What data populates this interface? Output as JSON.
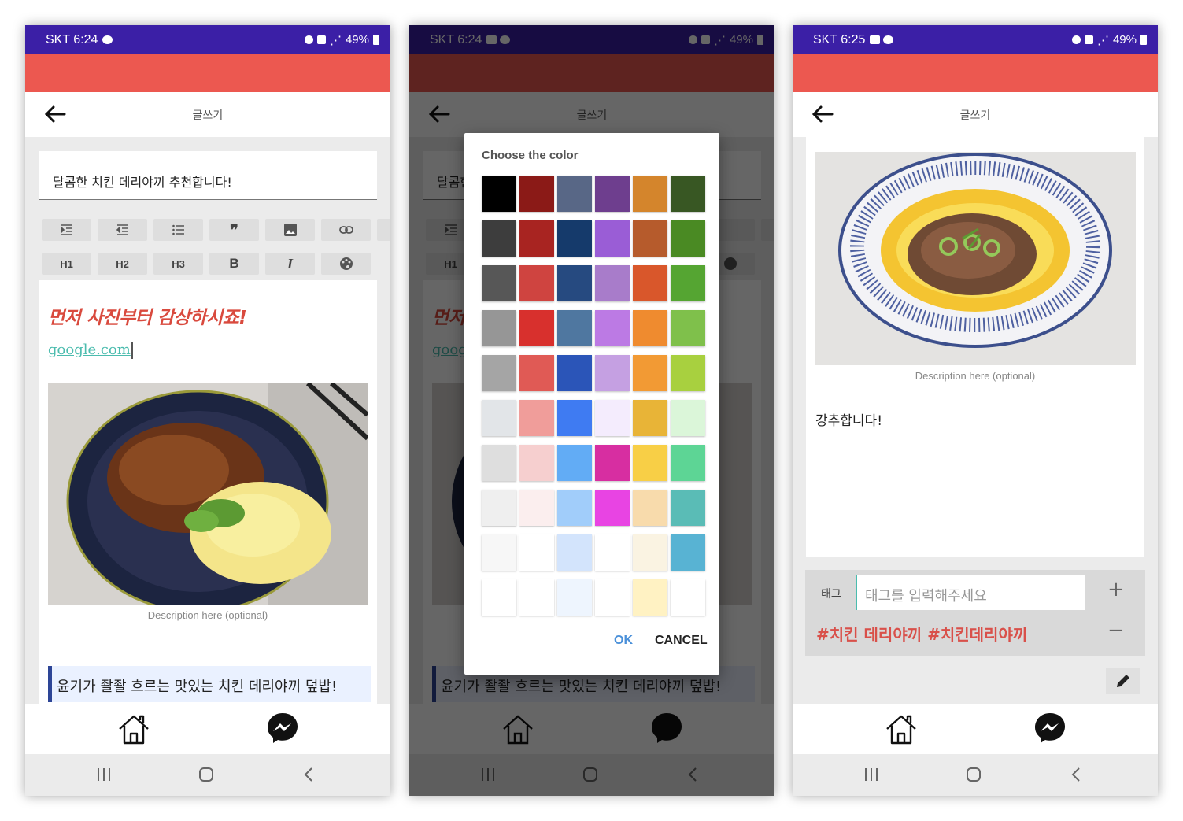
{
  "status": {
    "p1_time": "SKT 6:24",
    "p2_time": "SKT 6:24",
    "p3_time": "SKT 6:25",
    "battery": "49%"
  },
  "appbar": {
    "title": "글쓰기"
  },
  "editor": {
    "post_title": "달콤한 치킨 데리야끼 추천합니다!",
    "heading_text": "먼저 사진부터 감상하시죠!",
    "link_text": "google.com",
    "image_description": "Description here (optional)",
    "quote_text": "윤기가 좔좔 흐르는 맛있는 치킨 데리야끼 덮밥!",
    "toolbar": {
      "row1": [
        "indent-icon",
        "outdent-icon",
        "bullet-list-icon",
        "quote-icon",
        "image-icon",
        "link-icon",
        "trash-icon"
      ],
      "row2_labels": [
        "H1",
        "H2",
        "H3",
        "B",
        "I"
      ],
      "palette_icon": "palette-icon"
    }
  },
  "dialog": {
    "title": "Choose the color",
    "ok": "OK",
    "cancel": "CANCEL",
    "colors": [
      "#000000",
      "#8b1a17",
      "#586786",
      "#6e3e8e",
      "#d4852c",
      "#385723",
      "#3d3d3d",
      "#a82421",
      "#153a6b",
      "#9a5dd6",
      "#b65b2c",
      "#4a8a23",
      "#575757",
      "#cf4440",
      "#264a80",
      "#a87cca",
      "#d9572b",
      "#55a532",
      "#969696",
      "#d8302d",
      "#4f77a0",
      "#bc7ae4",
      "#ef8b2f",
      "#7fc04b",
      "#a5a5a5",
      "#e05a55",
      "#2b55b8",
      "#c5a0e2",
      "#f29a34",
      "#a8d03f",
      "#e2e5e8",
      "#f09d9a",
      "#3f7bf2",
      "#f4ecfd",
      "#e8b437",
      "#dbf6d9",
      "#dedede",
      "#f6cfcf",
      "#62acf5",
      "#d72ea1",
      "#f8cf46",
      "#5dd595",
      "#efefef",
      "#fbeeee",
      "#a1cdfa",
      "#e844e3",
      "#f8dbac",
      "#5abcb6",
      "#f7f7f7",
      "#ffffff",
      "#d3e4fc",
      "#ffffff",
      "#faf3e2",
      "#58b3d3",
      "#ffffff",
      "#ffffff",
      "#eef5fe",
      "#ffffff",
      "#fff2c3",
      "#ffffff"
    ]
  },
  "p3": {
    "image_description": "Description here (optional)",
    "body_text": "강추합니다!",
    "tag_label": "태그",
    "tag_placeholder": "태그를 입력해주세요",
    "tags_text": "#치킨 데리야끼 #치킨데리야끼",
    "plus": "+",
    "minus": "−"
  },
  "colors": {
    "statusbar": "#3b1fa6",
    "accent_red": "#ec5850",
    "teal": "#4bbcae",
    "quote_border": "#2d4596"
  }
}
